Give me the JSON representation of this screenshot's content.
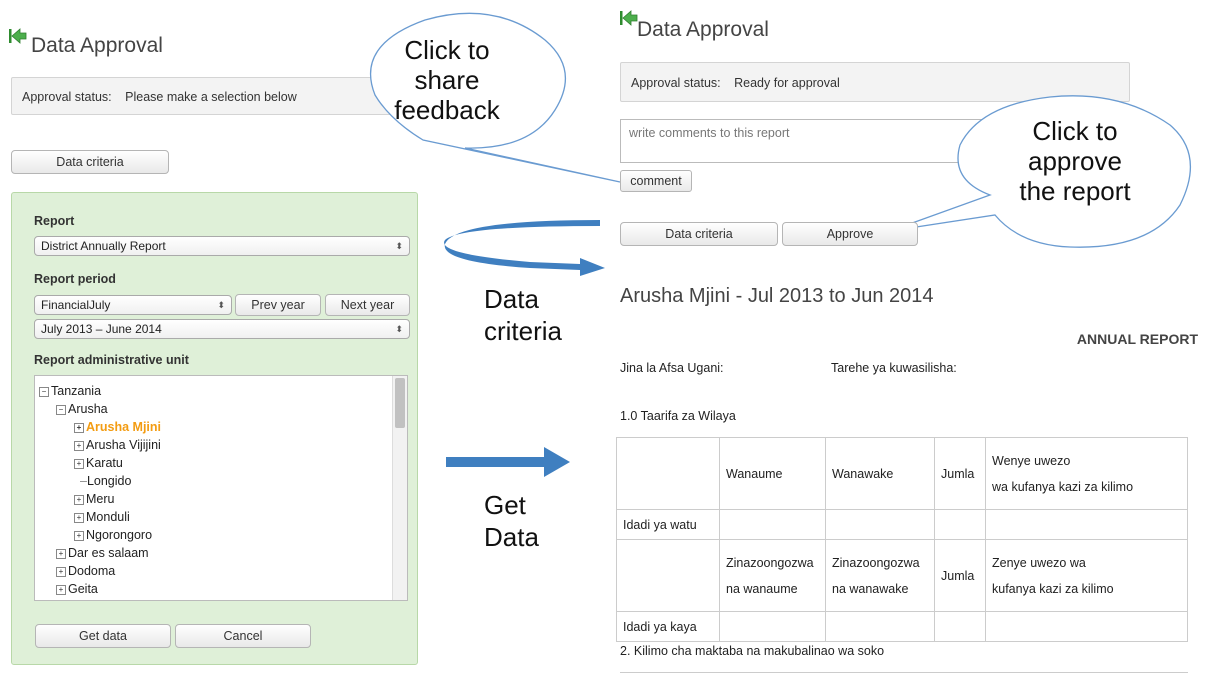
{
  "left": {
    "title": "Data Approval",
    "status_label": "Approval status:",
    "status_text": "Please make a selection below",
    "criteria_button": "Data criteria",
    "panel": {
      "report_label": "Report",
      "report_value": "District Annually Report",
      "period_label": "Report period",
      "period_type": "FinancialJuly",
      "prev_year": "Prev year",
      "next_year": "Next year",
      "period_value": "July 2013 – June 2014",
      "unit_label": "Report administrative unit",
      "tree": {
        "tanzania": "Tanzania",
        "arusha": "Arusha",
        "arusha_mjini": "Arusha Mjini",
        "arusha_vijijini": "Arusha Vijijini",
        "karatu": "Karatu",
        "longido": "Longido",
        "meru": "Meru",
        "monduli": "Monduli",
        "ngorongoro": "Ngorongoro",
        "dar_es_salaam": "Dar es salaam",
        "dodoma": "Dodoma",
        "geita": "Geita"
      },
      "get_data": "Get data",
      "cancel": "Cancel"
    }
  },
  "right": {
    "title": "Data Approval",
    "status_label": "Approval status:",
    "status_text": "Ready for approval",
    "comment_placeholder": "write comments to this report",
    "comment_button": "comment",
    "criteria_button": "Data criteria",
    "approve_button": "Approve",
    "report_title": "Arusha Mjini - Jul 2013 to Jun 2014",
    "annual_report": "ANNUAL REPORT",
    "afsa_label": "Jina la Afsa Ugani:",
    "tarehe_label": "Tarehe ya kuwasilisha:",
    "section1": "1.0 Taarifa za Wilaya",
    "table": {
      "h_wanaume": "Wanaume",
      "h_wanawake": "Wanawake",
      "h_jumla": "Jumla",
      "h_wenye1": "Wenye uwezo",
      "h_wenye2": "wa kufanya kazi za kilimo",
      "row_watu": "Idadi ya watu",
      "h2_zin_m1": "Zinazoongozwa",
      "h2_zin_m2": "na wanaume",
      "h2_zin_w1": "Zinazoongozwa",
      "h2_zin_w2": "na wanawake",
      "h2_jumla": "Jumla",
      "h2_zenye1": "Zenye uwezo wa",
      "h2_zenye2": "kufanya kazi za kilimo",
      "row_kaya": "Idadi ya kaya"
    },
    "section2": "2. Kilimo cha maktaba na makubalinao wa soko"
  },
  "callouts": {
    "feedback": [
      "Click to",
      "share",
      "feedback"
    ],
    "approve": [
      "Click to",
      "approve",
      "the report"
    ]
  },
  "annotations": {
    "data_criteria": [
      "Data",
      "criteria"
    ],
    "get_data": [
      "Get",
      "Data"
    ]
  },
  "colors": {
    "panel_green": "#dff0d8",
    "selected_orange": "#f39c12",
    "arrow_blue": "#3f7fc0"
  }
}
